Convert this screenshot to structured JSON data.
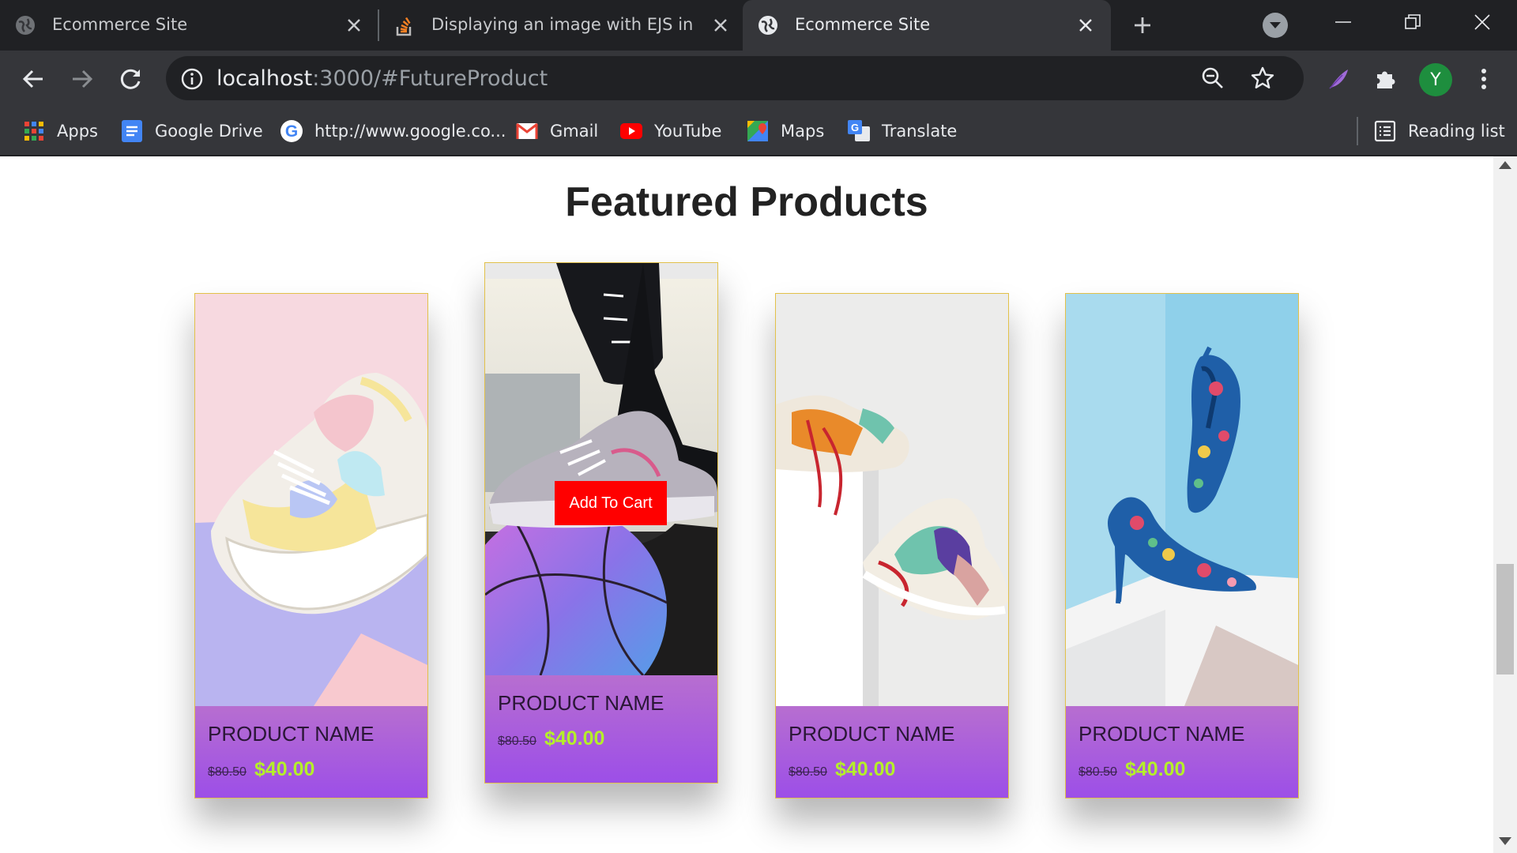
{
  "browser": {
    "tabs": [
      {
        "title": "Ecommerce Site",
        "icon": "globe-icon"
      },
      {
        "title": "Displaying an image with EJS in nod",
        "icon": "stackoverflow-icon"
      },
      {
        "title": "Ecommerce Site",
        "icon": "globe-icon",
        "active": true
      }
    ],
    "url_host": "localhost",
    "url_rest": ":3000/#FutureProduct",
    "avatar_letter": "Y",
    "bookmarks": [
      {
        "label": "Apps",
        "icon": "apps-grid-icon"
      },
      {
        "label": "Google Drive",
        "icon": "google-docs-icon"
      },
      {
        "label": "http://www.google.co...",
        "icon": "google-icon"
      },
      {
        "label": "Gmail",
        "icon": "gmail-icon"
      },
      {
        "label": "YouTube",
        "icon": "youtube-icon"
      },
      {
        "label": "Maps",
        "icon": "maps-icon"
      },
      {
        "label": "Translate",
        "icon": "translate-icon"
      }
    ],
    "reading_list": "Reading list"
  },
  "page": {
    "heading": "Featured Products",
    "add_to_cart": "Add To Cart",
    "products": [
      {
        "name": "PRODUCT NAME",
        "old_price": "$80.50",
        "price": "$40.00",
        "image": "pastel-sneaker"
      },
      {
        "name": "PRODUCT NAME",
        "old_price": "$80.50",
        "price": "$40.00",
        "image": "sneaker-on-basketball"
      },
      {
        "name": "PRODUCT NAME",
        "old_price": "$80.50",
        "price": "$40.00",
        "image": "two-sneakers"
      },
      {
        "name": "PRODUCT NAME",
        "old_price": "$80.50",
        "price": "$40.00",
        "image": "floral-heels"
      }
    ]
  },
  "colors": {
    "card_gradient_top": "#b76ed0",
    "card_gradient_bottom": "#9c4ee8",
    "price": "#b5ef2a",
    "button": "#ff0000"
  }
}
